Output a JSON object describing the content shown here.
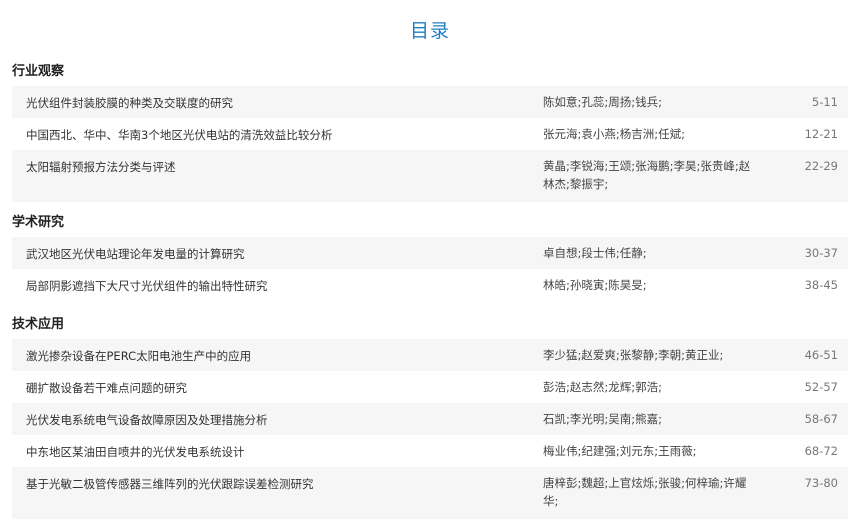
{
  "title": "目录",
  "sections": [
    {
      "name": "行业观察",
      "articles": [
        {
          "title": "光伏组件封装胶膜的种类及交联度的研究",
          "authors": "陈如意;孔蕊;周扬;钱兵;",
          "pages": "5-11"
        },
        {
          "title": "中国西北、华中、华南3个地区光伏电站的清洗效益比较分析",
          "authors": "张元海;袁小燕;杨吉洲;任斌;",
          "pages": "12-21"
        },
        {
          "title": "太阳辐射预报方法分类与评述",
          "authors": "黄晶;李锐海;王颂;张海鹏;李昊;张贵峰;赵林杰;黎振宇;",
          "pages": "22-29"
        }
      ]
    },
    {
      "name": "学术研究",
      "articles": [
        {
          "title": "武汉地区光伏电站理论年发电量的计算研究",
          "authors": "卓自想;段士伟;任静;",
          "pages": "30-37"
        },
        {
          "title": "局部阴影遮挡下大尺寸光伏组件的输出特性研究",
          "authors": "林皓;孙晓寅;陈昊旻;",
          "pages": "38-45"
        }
      ]
    },
    {
      "name": "技术应用",
      "articles": [
        {
          "title": "激光掺杂设备在PERC太阳电池生产中的应用",
          "authors": "李少猛;赵爱爽;张黎静;李朝;黄正业;",
          "pages": "46-51"
        },
        {
          "title": "硼扩散设备若干难点问题的研究",
          "authors": "彭浩;赵志然;龙辉;郭浩;",
          "pages": "52-57"
        },
        {
          "title": "光伏发电系统电气设备故障原因及处理措施分析",
          "authors": "石凯;李光明;吴南;熊嘉;",
          "pages": "58-67"
        },
        {
          "title": "中东地区某油田自喷井的光伏发电系统设计",
          "authors": "梅业伟;纪建强;刘元东;王雨薇;",
          "pages": "68-72"
        },
        {
          "title": "基于光敏二极管传感器三维阵列的光伏跟踪误差检测研究",
          "authors": "唐梓彭;魏超;上官炫烁;张骏;何梓瑜;许耀华;",
          "pages": "73-80"
        }
      ]
    }
  ]
}
